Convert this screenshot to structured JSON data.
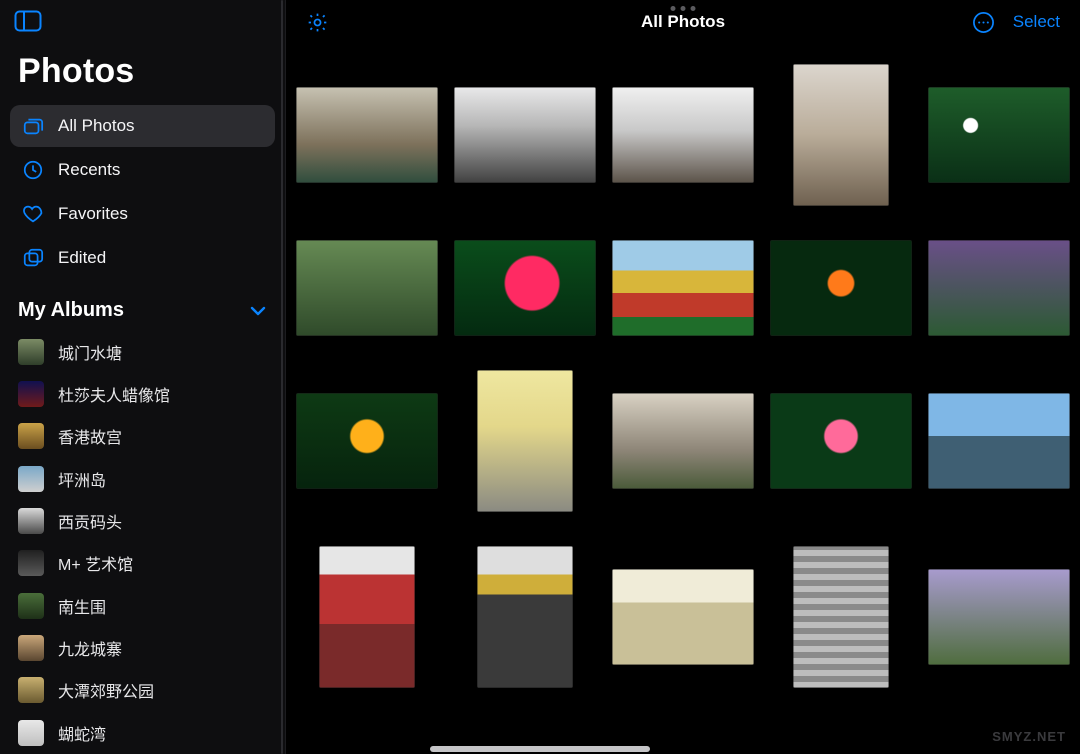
{
  "app": {
    "title": "Photos"
  },
  "header": {
    "title": "All Photos",
    "select_label": "Select"
  },
  "sidebar": {
    "nav": [
      {
        "icon": "stack-icon",
        "label": "All Photos",
        "selected": true
      },
      {
        "icon": "clock-icon",
        "label": "Recents",
        "selected": false
      },
      {
        "icon": "heart-icon",
        "label": "Favorites",
        "selected": false
      },
      {
        "icon": "edited-icon",
        "label": "Edited",
        "selected": false
      }
    ],
    "albums_title": "My Albums",
    "albums": [
      {
        "label": "城门水塘",
        "swatch": "a0"
      },
      {
        "label": "杜莎夫人蜡像馆",
        "swatch": "a1"
      },
      {
        "label": "香港故宫",
        "swatch": "a2"
      },
      {
        "label": "坪洲岛",
        "swatch": "a3"
      },
      {
        "label": "西贡码头",
        "swatch": "a4"
      },
      {
        "label": "M+ 艺术馆",
        "swatch": "a5"
      },
      {
        "label": "南生围",
        "swatch": "a6"
      },
      {
        "label": "九龙城寨",
        "swatch": "a7"
      },
      {
        "label": "大潭郊野公园",
        "swatch": "a8"
      },
      {
        "label": "蝴蛇湾",
        "swatch": "a9"
      }
    ]
  },
  "grid": {
    "rows": [
      [
        {
          "o": "land",
          "t": "t-arch"
        },
        {
          "o": "land",
          "t": "t-pav"
        },
        {
          "o": "land",
          "t": "t-court"
        },
        {
          "o": "port",
          "t": "t-stele"
        },
        {
          "o": "land",
          "t": "t-flw1"
        }
      ],
      [
        {
          "o": "land",
          "t": "t-shrub"
        },
        {
          "o": "land",
          "t": "t-rose"
        },
        {
          "o": "land",
          "t": "t-beds"
        },
        {
          "o": "land",
          "t": "t-orange"
        },
        {
          "o": "land",
          "t": "t-purple"
        }
      ],
      [
        {
          "o": "land",
          "t": "t-lant"
        },
        {
          "o": "port",
          "t": "t-pole"
        },
        {
          "o": "land",
          "t": "t-brch"
        },
        {
          "o": "land",
          "t": "t-hib"
        },
        {
          "o": "land",
          "t": "t-harb"
        }
      ],
      [
        {
          "o": "port",
          "t": "t-tmpl"
        },
        {
          "o": "port",
          "t": "t-alley"
        },
        {
          "o": "land",
          "t": "t-gate"
        },
        {
          "o": "port",
          "t": "t-steps"
        },
        {
          "o": "land",
          "t": "t-lilac"
        }
      ]
    ]
  },
  "watermark": "SMYZ.NET"
}
